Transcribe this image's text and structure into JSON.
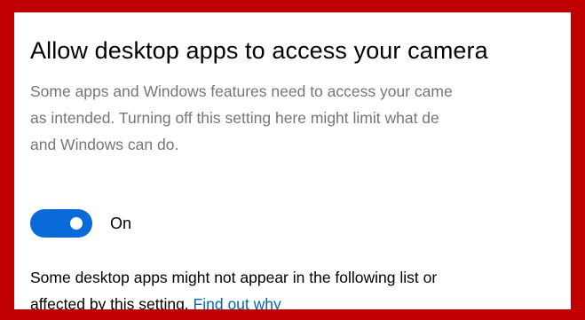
{
  "section": {
    "title": "Allow desktop apps to access your camera",
    "description_lines": [
      "Some apps and Windows features need to access your came",
      "as intended. Turning off this setting here might limit what de",
      "and Windows can do."
    ]
  },
  "toggle": {
    "state": "On",
    "checked": true,
    "accent_color": "#0a6ad8"
  },
  "note": {
    "line1": "Some desktop apps might not appear in the following list or",
    "line2_prefix": "affected by this setting. ",
    "link_label": "Find out why"
  },
  "colors": {
    "frame_border": "#c00000",
    "description_text": "#767676",
    "link": "#0067c0"
  }
}
